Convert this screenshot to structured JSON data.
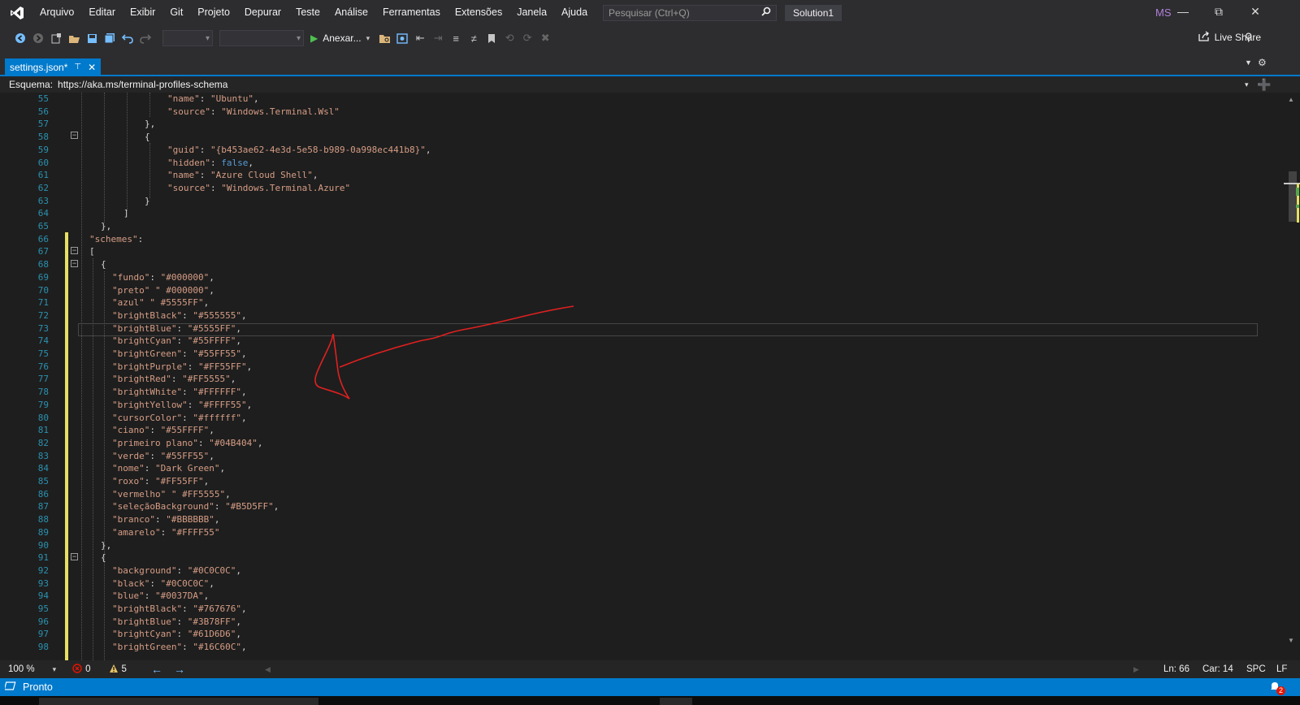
{
  "menubar": {
    "items": [
      "Arquivo",
      "Editar",
      "Exibir",
      "Git",
      "Projeto",
      "Depurar",
      "Teste",
      "Análise",
      "Ferramentas",
      "Extensões",
      "Janela",
      "Ajuda"
    ],
    "search_placeholder": "Pesquisar (Ctrl+Q)",
    "solution": "Solution1",
    "avatar": "MS"
  },
  "toolbar": {
    "run_label": "Anexar...",
    "live_share": "Live Share"
  },
  "tab": {
    "title": "settings.json*"
  },
  "schema": {
    "label": "Esquema:",
    "value": "https://aka.ms/terminal-profiles-schema"
  },
  "editor": {
    "lines": [
      {
        "n": "55",
        "text": "\"name\": \"Ubuntu\","
      },
      {
        "n": "56",
        "text": "\"source\": \"Windows.Terminal.Wsl\""
      },
      {
        "n": "57",
        "text": "},"
      },
      {
        "n": "58",
        "text": "{"
      },
      {
        "n": "59",
        "text": "\"guid\": \"{b453ae62-4e3d-5e58-b989-0a998ec441b8}\","
      },
      {
        "n": "60",
        "text": "\"hidden\": false,"
      },
      {
        "n": "61",
        "text": "\"name\": \"Azure Cloud Shell\","
      },
      {
        "n": "62",
        "text": "\"source\": \"Windows.Terminal.Azure\""
      },
      {
        "n": "63",
        "text": "}"
      },
      {
        "n": "64",
        "text": "]"
      },
      {
        "n": "65",
        "text": "},"
      },
      {
        "n": "66",
        "text": "\"schemes\":"
      },
      {
        "n": "67",
        "text": "["
      },
      {
        "n": "68",
        "text": "{"
      },
      {
        "n": "69",
        "text": "\"fundo\": \"#000000\","
      },
      {
        "n": "70",
        "text": "\"preto\" \" #000000\","
      },
      {
        "n": "71",
        "text": "\"azul\" \" #5555FF\","
      },
      {
        "n": "72",
        "text": "\"brightBlack\": \"#555555\","
      },
      {
        "n": "73",
        "text": "\"brightBlue\": \"#5555FF\","
      },
      {
        "n": "74",
        "text": "\"brightCyan\": \"#55FFFF\","
      },
      {
        "n": "75",
        "text": "\"brightGreen\": \"#55FF55\","
      },
      {
        "n": "76",
        "text": "\"brightPurple\": \"#FF55FF\","
      },
      {
        "n": "77",
        "text": "\"brightRed\": \"#FF5555\","
      },
      {
        "n": "78",
        "text": "\"brightWhite\": \"#FFFFFF\","
      },
      {
        "n": "79",
        "text": "\"brightYellow\": \"#FFFF55\","
      },
      {
        "n": "80",
        "text": "\"cursorColor\": \"#ffffff\","
      },
      {
        "n": "81",
        "text": "\"ciano\": \"#55FFFF\","
      },
      {
        "n": "82",
        "text": "\"primeiro plano\": \"#04B404\","
      },
      {
        "n": "83",
        "text": "\"verde\": \"#55FF55\","
      },
      {
        "n": "84",
        "text": "\"nome\": \"Dark Green\","
      },
      {
        "n": "85",
        "text": "\"roxo\": \"#FF55FF\","
      },
      {
        "n": "86",
        "text": "\"vermelho\" \" #FF5555\","
      },
      {
        "n": "87",
        "text": "\"seleçãoBackground\": \"#B5D5FF\","
      },
      {
        "n": "88",
        "text": "\"branco\": \"#BBBBBB\","
      },
      {
        "n": "89",
        "text": "\"amarelo\": \"#FFFF55\""
      },
      {
        "n": "90",
        "text": "},"
      },
      {
        "n": "91",
        "text": "{"
      },
      {
        "n": "92",
        "text": "\"background\": \"#0C0C0C\","
      },
      {
        "n": "93",
        "text": "\"black\": \"#0C0C0C\","
      },
      {
        "n": "94",
        "text": "\"blue\": \"#0037DA\","
      },
      {
        "n": "95",
        "text": "\"brightBlack\": \"#767676\","
      },
      {
        "n": "96",
        "text": "\"brightBlue\": \"#3B78FF\","
      },
      {
        "n": "97",
        "text": "\"brightCyan\": \"#61D6D6\","
      },
      {
        "n": "98",
        "text": "\"brightGreen\": \"#16C60C\","
      }
    ]
  },
  "status_row": {
    "zoom": "100 %",
    "errors": "0",
    "warnings": "5",
    "line": "Ln: 66",
    "col": "Car: 14",
    "spc": "SPC",
    "eol": "LF"
  },
  "statusbar": {
    "text": "Pronto",
    "notifications": "2"
  },
  "colors": {
    "accent": "#007acc",
    "annotation": "#e02020"
  }
}
